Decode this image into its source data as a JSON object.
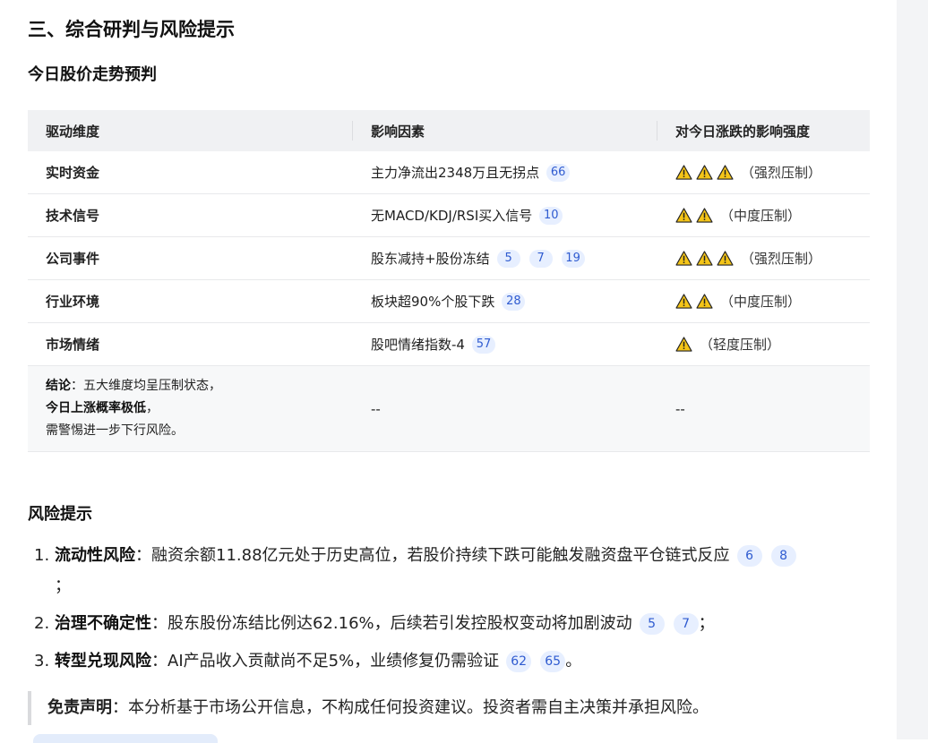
{
  "section_title": "三、综合研判与风险提示",
  "forecast_title": "今日股价走势预判",
  "table": {
    "headers": [
      "驱动维度",
      "影响因素",
      "对今日涨跌的影响强度"
    ],
    "rows": [
      {
        "dimension": "实时资金",
        "factor": "主力净流出2348万且无拐点",
        "refs": [
          "66"
        ],
        "impact_level": 3,
        "impact_label": "（强烈压制）"
      },
      {
        "dimension": "技术信号",
        "factor": "无MACD/KDJ/RSI买入信号",
        "refs": [
          "10"
        ],
        "impact_level": 2,
        "impact_label": "（中度压制）"
      },
      {
        "dimension": "公司事件",
        "factor": "股东减持+股份冻结",
        "refs": [
          "5",
          "7",
          "19"
        ],
        "impact_level": 3,
        "impact_label": "（强烈压制）"
      },
      {
        "dimension": "行业环境",
        "factor": "板块超90%个股下跌",
        "refs": [
          "28"
        ],
        "impact_level": 2,
        "impact_label": "（中度压制）"
      },
      {
        "dimension": "市场情绪",
        "factor": "股吧情绪指数-4",
        "refs": [
          "57"
        ],
        "impact_level": 1,
        "impact_label": "（轻度压制）"
      }
    ],
    "conclusion": {
      "label": "结论",
      "line1": "：五大维度均呈压制状态，",
      "line2": "今日上涨概率极低",
      "line2_suffix": "，",
      "line3": "需警惕进一步下行风险。",
      "factor": "--",
      "impact": "--"
    }
  },
  "risk_title": "风险提示",
  "risks": [
    {
      "num": "1.",
      "title": "流动性风险",
      "text": "：融资余额11.88亿元处于历史高位，若股价持续下跌可能触发融资盘平仓链式反应",
      "refs": [
        "6",
        "8"
      ],
      "end": "；"
    },
    {
      "num": "2.",
      "title": "治理不确定性",
      "text": "：股东股份冻结比例达62.16%，后续若引发控股权变动将加剧波动",
      "refs": [
        "5",
        "7"
      ],
      "end": "；"
    },
    {
      "num": "3.",
      "title": "转型兑现风险",
      "text": "：AI产品收入贡献尚不足5%，业绩修复仍需验证",
      "refs": [
        "62",
        "65"
      ],
      "end": "。"
    }
  ],
  "disclaimer": {
    "label": "免责声明",
    "text": "：本分析基于市场公开信息，不构成任何投资建议。投资者需自主决策并承担风险。"
  },
  "colors": {
    "warning_fill": "#f5c518",
    "citation_bg": "#e7efff",
    "citation_text": "#2f5bd0",
    "header_bg": "#f0f1f3"
  }
}
